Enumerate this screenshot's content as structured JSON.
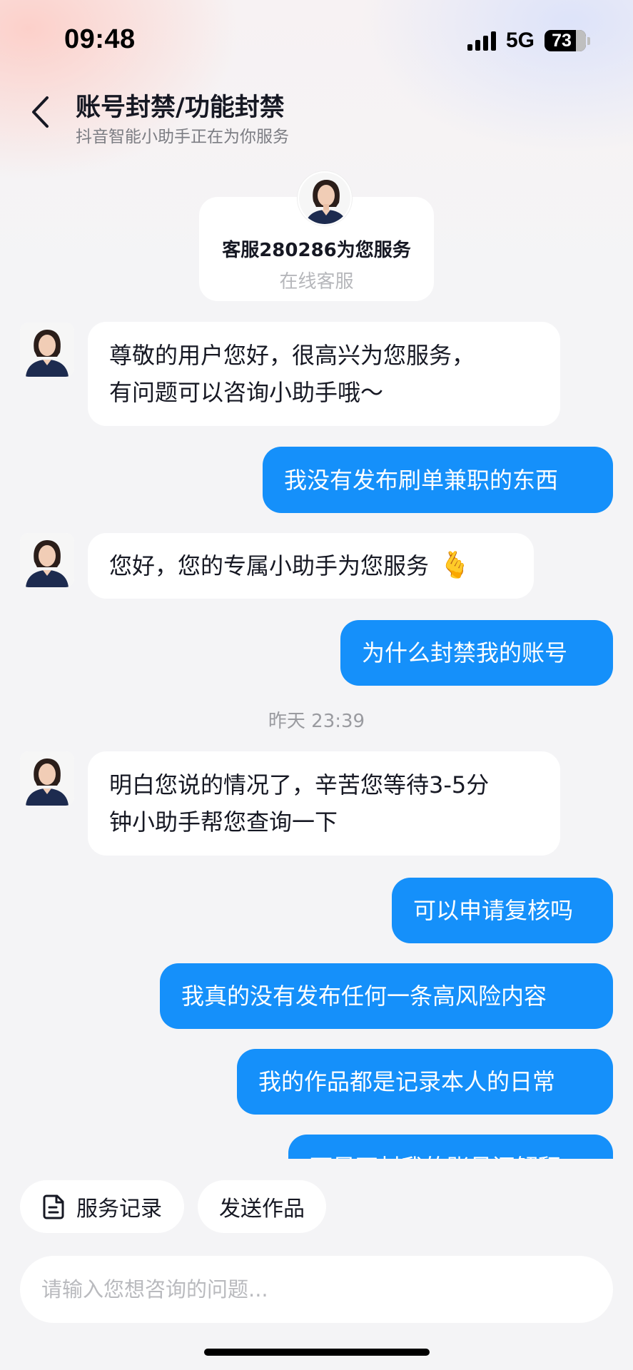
{
  "status_bar": {
    "time": "09:48",
    "network": "5G",
    "battery": "73"
  },
  "header": {
    "title": "账号封禁/功能封禁",
    "subtitle": "抖音智能小助手正在为你服务"
  },
  "agent_card": {
    "name": "客服280286为您服务",
    "status": "在线客服"
  },
  "messages": [
    {
      "from": "agent",
      "line1": "尊敬的用户您好，很高兴为您服务，",
      "line2": "有问题可以咨询小助手哦～"
    },
    {
      "from": "user",
      "text": "我没有发布刷单兼职的东西"
    },
    {
      "from": "agent",
      "text": "您好，您的专属小助手为您服务",
      "emoji": "🫰"
    },
    {
      "from": "user",
      "text": "为什么封禁我的账号"
    },
    {
      "from": "agent",
      "line1": "明白您说的情况了，辛苦您等待3-5分",
      "line2": "钟小助手帮您查询一下"
    },
    {
      "from": "user",
      "text": "可以申请复核吗"
    },
    {
      "from": "user",
      "text": "我真的没有发布任何一条高风险内容"
    },
    {
      "from": "user",
      "text": "我的作品都是记录本人的日常"
    },
    {
      "from": "user",
      "text": "可是不封我的账号还解释"
    }
  ],
  "timestamp": "昨天 23:39",
  "quick_actions": {
    "service_record": "服务记录",
    "send_work": "发送作品"
  },
  "input": {
    "placeholder": "请输入您想咨询的问题..."
  },
  "colors": {
    "user_bubble": "#1590fa",
    "agent_bubble": "#ffffff",
    "background": "#f4f4f6"
  }
}
